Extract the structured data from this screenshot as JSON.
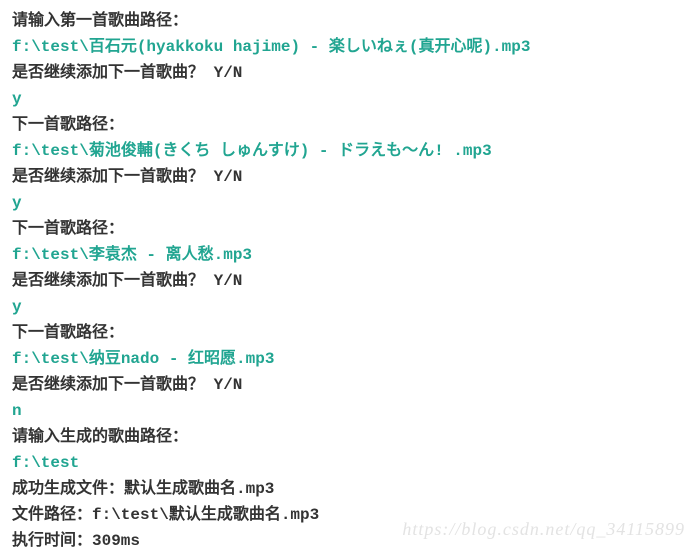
{
  "console": {
    "lines": [
      {
        "text": "请输入第一首歌曲路径：",
        "cls": "black"
      },
      {
        "text": "f:\\test\\百石元(hyakkoku hajime) - 楽しいねぇ(真开心呢).mp3",
        "cls": "teal"
      },
      {
        "text": "是否继续添加下一首歌曲？ Y/N",
        "cls": "black"
      },
      {
        "text": "y",
        "cls": "teal"
      },
      {
        "text": "下一首歌路径：",
        "cls": "black"
      },
      {
        "text": "f:\\test\\菊池俊輔(きくち しゅんすけ) - ドラえも～ん! .mp3",
        "cls": "teal"
      },
      {
        "text": "是否继续添加下一首歌曲？ Y/N",
        "cls": "black"
      },
      {
        "text": "y",
        "cls": "teal"
      },
      {
        "text": "下一首歌路径：",
        "cls": "black"
      },
      {
        "text": "f:\\test\\李袁杰 - 离人愁.mp3",
        "cls": "teal"
      },
      {
        "text": "是否继续添加下一首歌曲？ Y/N",
        "cls": "black"
      },
      {
        "text": "y",
        "cls": "teal"
      },
      {
        "text": "下一首歌路径：",
        "cls": "black"
      },
      {
        "text": "f:\\test\\纳豆nado - 红昭愿.mp3",
        "cls": "teal"
      },
      {
        "text": "是否继续添加下一首歌曲？ Y/N",
        "cls": "black"
      },
      {
        "text": "n",
        "cls": "teal"
      },
      {
        "text": "请输入生成的歌曲路径：",
        "cls": "black"
      },
      {
        "text": "f:\\test",
        "cls": "teal"
      },
      {
        "text": "成功生成文件：默认生成歌曲名.mp3",
        "cls": "black"
      },
      {
        "text": "文件路径：f:\\test\\默认生成歌曲名.mp3",
        "cls": "black"
      },
      {
        "text": "执行时间：309ms",
        "cls": "black"
      }
    ]
  },
  "watermark": "https://blog.csdn.net/qq_34115899"
}
